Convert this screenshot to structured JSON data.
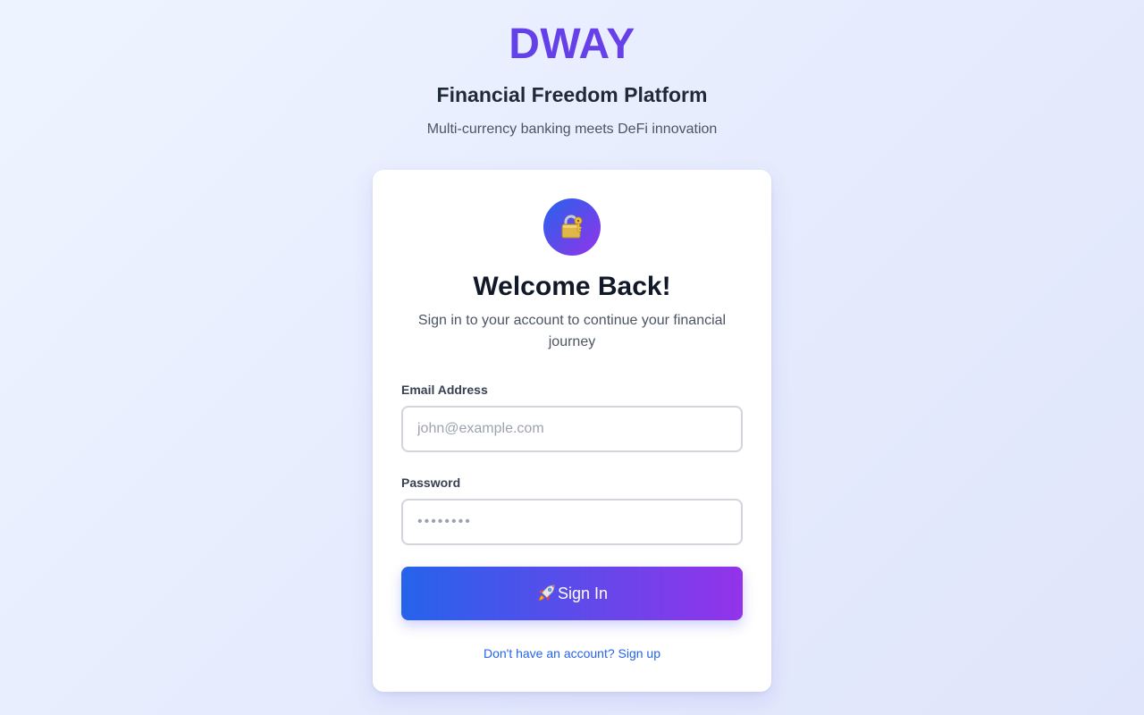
{
  "header": {
    "brand": "DWAY",
    "tagline": "Financial Freedom Platform",
    "subtagline": "Multi-currency banking meets DeFi innovation"
  },
  "card": {
    "icon": "lock-with-key-icon",
    "title": "Welcome Back!",
    "subtitle": "Sign in to your account to continue your financial journey",
    "email": {
      "label": "Email Address",
      "placeholder": "john@example.com",
      "value": ""
    },
    "password": {
      "label": "Password",
      "placeholder": "••••••••",
      "value": ""
    },
    "submit": {
      "icon": "rocket-icon",
      "label": "Sign In"
    },
    "signup_link": "Don't have an account? Sign up"
  },
  "colors": {
    "accent_start": "#2563eb",
    "accent_end": "#9333ea",
    "brand_text": "#4f46e5",
    "link": "#2563eb"
  }
}
